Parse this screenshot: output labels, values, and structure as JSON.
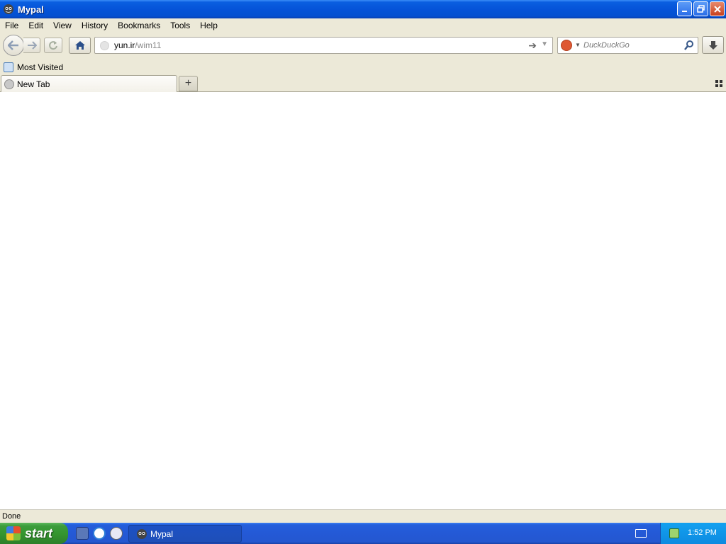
{
  "window": {
    "title": "Mypal",
    "controls": {
      "minimize": "minimize",
      "restore": "restore",
      "close": "close"
    }
  },
  "menu": [
    "File",
    "Edit",
    "View",
    "History",
    "Bookmarks",
    "Tools",
    "Help"
  ],
  "navigation": {
    "url_host": "yun.ir",
    "url_path": "/wim11",
    "search_placeholder": "DuckDuckGo",
    "search_engine_icon": "duckduckgo-icon"
  },
  "bookmarks": {
    "items": [
      {
        "label": "Most Visited",
        "icon": "most-visited-icon"
      }
    ]
  },
  "tabs": [
    {
      "label": "New Tab",
      "icon": "globe-icon",
      "active": true
    }
  ],
  "status": {
    "text": "Done"
  },
  "taskbar": {
    "start_label": "start",
    "quick_launch": [
      "mypal-quicklaunch-icon",
      "internet-explorer-icon",
      "media-player-icon"
    ],
    "tasks": [
      {
        "label": "Mypal",
        "icon": "mypal-icon"
      }
    ],
    "clock": "1:52 PM"
  },
  "colors": {
    "titlebar": "#0553d8",
    "chrome": "#ece9d8",
    "taskbar": "#245edb",
    "start": "#3c9c3c",
    "tray": "#0d8ae0"
  }
}
